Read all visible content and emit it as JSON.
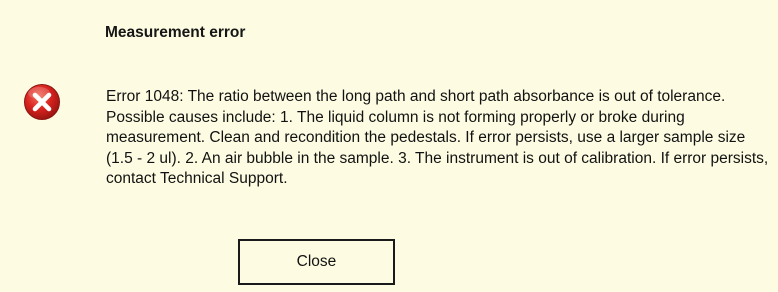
{
  "dialog": {
    "title": "Measurement error",
    "icon": "error-x-icon",
    "message": "Error 1048: The ratio between the long path and short path absorbance is out of tolerance. Possible causes include: 1. The liquid column is not forming properly or broke during measurement. Clean and recondition the pedestals. If error persists, use a larger sample size (1.5 - 2 ul). 2. An air bubble in the sample. 3. The instrument is out of calibration.  If error persists, contact Technical Support.",
    "close_label": "Close"
  },
  "colors": {
    "background": "#fdfce2",
    "icon_red": "#d8231f",
    "border": "#1a1a1a"
  }
}
